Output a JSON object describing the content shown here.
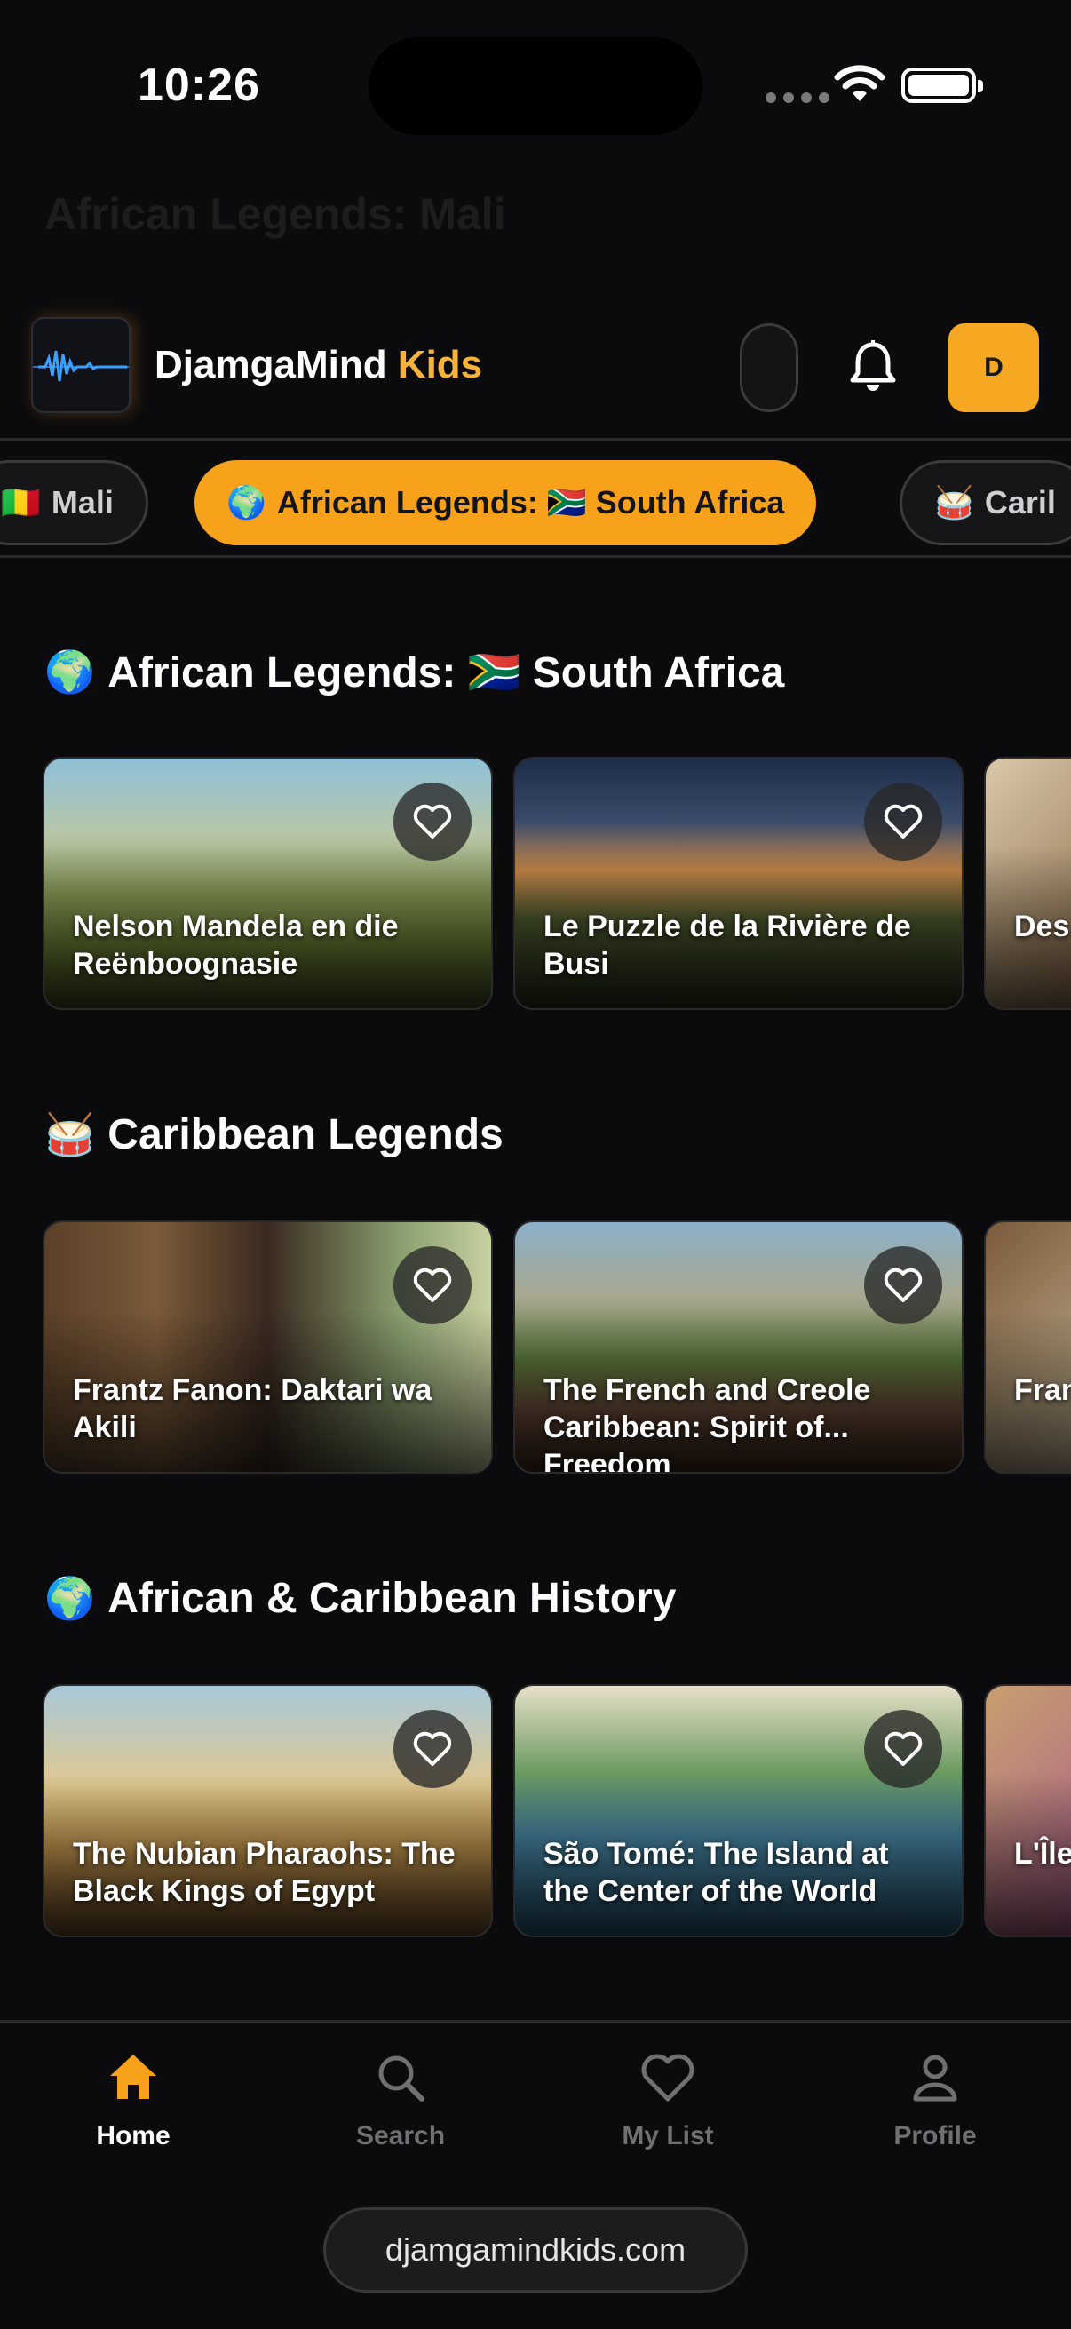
{
  "status_bar": {
    "time": "10:26"
  },
  "ghost": {
    "title": "African Legends: Mali"
  },
  "header": {
    "app_name_part1": "DjamgaMind",
    "app_name_part2": " Kids",
    "avatar_initial": "D"
  },
  "chips": [
    {
      "emoji": "🇲🇱",
      "label": "Mali",
      "active": false
    },
    {
      "emoji": "🌍",
      "label": "African Legends: 🇿🇦 South Africa",
      "active": true
    },
    {
      "emoji": "🥁",
      "label": "Caril",
      "active": false
    }
  ],
  "sections": [
    {
      "emoji": "🌍",
      "title": "African Legends: 🇿🇦 South Africa",
      "cards": [
        {
          "title": "Nelson Mandela en die Reënboognasie"
        },
        {
          "title": "Le Puzzle de la Rivière de Busi"
        },
        {
          "title": "Des Piis-"
        }
      ]
    },
    {
      "emoji": "🥁",
      "title": "Caribbean Legends",
      "cards": [
        {
          "title": "Frantz Fanon: Daktari wa Akili"
        },
        {
          "title": "The French and Creole Caribbean: Spirit of... Freedom"
        },
        {
          "title": "Fran a"
        }
      ]
    },
    {
      "emoji": "🌍",
      "title": "African & Caribbean History",
      "cards": [
        {
          "title": "The Nubian Pharaohs: The Black Kings of Egypt"
        },
        {
          "title": "São Tomé: The Island at the Center of the World"
        },
        {
          "title": "L'Île du S"
        }
      ]
    }
  ],
  "tabs": [
    {
      "label": "Home",
      "icon": "home-icon",
      "active": true
    },
    {
      "label": "Search",
      "icon": "search-icon",
      "active": false
    },
    {
      "label": "My List",
      "icon": "heart-icon",
      "active": false
    },
    {
      "label": "Profile",
      "icon": "profile-icon",
      "active": false
    }
  ],
  "url": "djamgamindkids.com",
  "colors": {
    "accent": "#f8a11b",
    "background": "#0b0b0d"
  }
}
